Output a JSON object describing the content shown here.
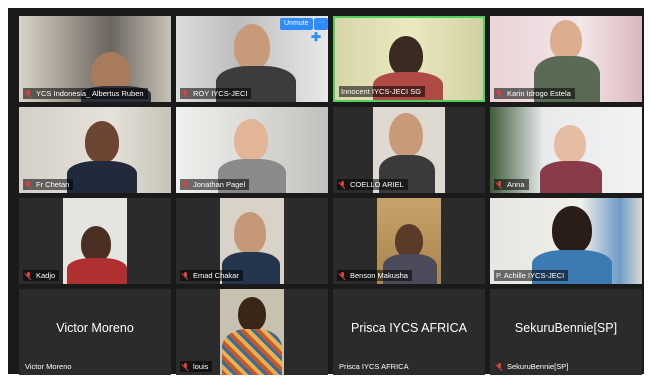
{
  "participants": [
    {
      "label": "YCS Indonesia_ Albertus Ruben",
      "muted": true
    },
    {
      "label": "ROY IYCS-JECI",
      "muted": true
    },
    {
      "label": "Innocent IYCS-JECI SG",
      "muted": false
    },
    {
      "label": "Karin Idrogo Estela",
      "muted": true
    },
    {
      "label": "Fr Chetan",
      "muted": true
    },
    {
      "label": "Jonathan Pagel",
      "muted": true
    },
    {
      "label": "COELLO ARIEL",
      "muted": true
    },
    {
      "label": "Anna",
      "muted": true
    },
    {
      "label": "Kadjo",
      "muted": true
    },
    {
      "label": "Emad Chakar",
      "muted": true
    },
    {
      "label": "Benson Makusha",
      "muted": true
    },
    {
      "label": "P. Achille IYCS-JECI",
      "muted": false
    },
    {
      "label": "Victor Moreno",
      "display_name": "Victor Moreno",
      "muted": false
    },
    {
      "label": "louis",
      "muted": true
    },
    {
      "label": "Prisca IYCS AFRICA",
      "display_name": "Prisca IYCS AFRICA",
      "muted": false
    },
    {
      "label": "SekuruBennie[SP]",
      "display_name": "SekuruBennie[SP]",
      "muted": true
    }
  ],
  "controls": {
    "unmute_label": "Unmute",
    "more_label": "···"
  },
  "colors": {
    "active_speaker_border": "#4fd05a",
    "button_blue": "#2d8cff",
    "muted_icon": "#e24040"
  }
}
